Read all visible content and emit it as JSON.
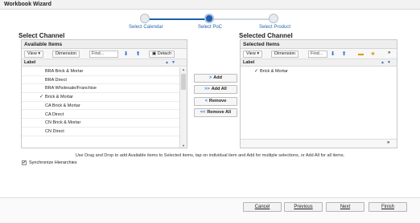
{
  "window": {
    "title": "Workbook Wizard"
  },
  "steps": [
    {
      "label": "Select Calendar",
      "state": "done"
    },
    {
      "label": "Select PoC",
      "state": "active"
    },
    {
      "label": "Select Product",
      "state": "pending"
    }
  ],
  "left": {
    "section_title": "Select Channel",
    "panel_title": "Available Items",
    "toolbar": {
      "view": "View ▾",
      "dimension": "Dimension",
      "find_placeholder": "Find...",
      "detach": "Detach"
    },
    "column": "Label",
    "rows": [
      {
        "label": "BRA Brick & Mortar",
        "checked": false
      },
      {
        "label": "BRA Direct",
        "checked": false
      },
      {
        "label": "BRA Wholesale/Franchise",
        "checked": false
      },
      {
        "label": "Brick & Mortar",
        "checked": true
      },
      {
        "label": "CA Brick & Mortar",
        "checked": false
      },
      {
        "label": "CA Direct",
        "checked": false
      },
      {
        "label": "CN Brick & Mortar",
        "checked": false
      },
      {
        "label": "CN Direct",
        "checked": false
      }
    ]
  },
  "shuttle": {
    "add": "Add",
    "add_all": "Add All",
    "remove": "Remove",
    "remove_all": "Remove All"
  },
  "right": {
    "section_title": "Selected Channel",
    "panel_title": "Selected Items",
    "toolbar": {
      "view": "View ▾",
      "dimension": "Dimension",
      "find_placeholder": "Find...",
      "more": "»"
    },
    "column": "Label",
    "rows": [
      {
        "label": "Brick & Mortar",
        "checked": true
      }
    ],
    "footer_more": "»"
  },
  "hint": "Use Drag and Drop to add Available items to Selected items, tap on individual item and Add for multiple selections, or Add All for all items.",
  "sync": {
    "label": "Synchronize Hierarchies",
    "checked": true,
    "mark": "✔"
  },
  "footer": {
    "cancel": "Cancel",
    "previous": "Previous",
    "next": "Next",
    "finish": "Finish"
  },
  "icons": {
    "check": "✓",
    "up": "▲",
    "down": "▼",
    "arrow_right": "➔"
  },
  "colors": {
    "accent": "#1f5fa8",
    "link": "#2a68b0"
  }
}
